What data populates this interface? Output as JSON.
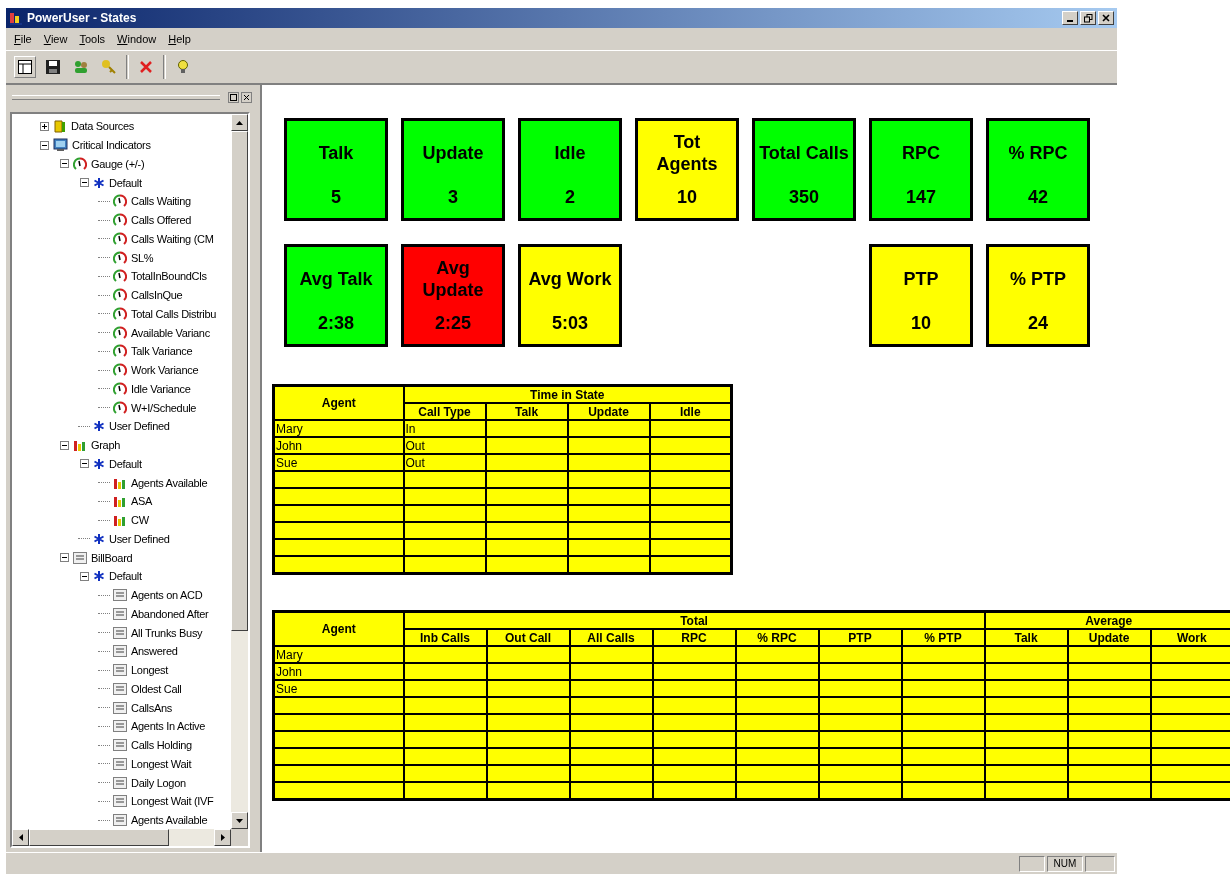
{
  "window": {
    "title": "PowerUser - States"
  },
  "menu": [
    "File",
    "View",
    "Tools",
    "Window",
    "Help"
  ],
  "tree": [
    {
      "label": "Data Sources",
      "kind": "folder",
      "expanded": false
    },
    {
      "label": "Critical Indicators",
      "kind": "monitor",
      "expanded": true,
      "children": [
        {
          "label": "Gauge (+/-)",
          "kind": "gauge",
          "expanded": true,
          "children": [
            {
              "label": "Default",
              "kind": "star",
              "expanded": true,
              "children": [
                {
                  "label": "Calls Waiting",
                  "kind": "gauge"
                },
                {
                  "label": "Calls Offered",
                  "kind": "gauge"
                },
                {
                  "label": "Calls Waiting (CM",
                  "kind": "gauge"
                },
                {
                  "label": "SL%",
                  "kind": "gauge"
                },
                {
                  "label": "TotalInBoundCls",
                  "kind": "gauge"
                },
                {
                  "label": "CallsInQue",
                  "kind": "gauge"
                },
                {
                  "label": "Total Calls Distribu",
                  "kind": "gauge"
                },
                {
                  "label": "Available Varianc",
                  "kind": "gauge"
                },
                {
                  "label": "Talk Variance",
                  "kind": "gauge"
                },
                {
                  "label": "Work Variance",
                  "kind": "gauge"
                },
                {
                  "label": "Idle Variance",
                  "kind": "gauge"
                },
                {
                  "label": "W+I/Schedule",
                  "kind": "gauge"
                }
              ]
            },
            {
              "label": "User Defined",
              "kind": "star"
            }
          ]
        },
        {
          "label": "Graph",
          "kind": "graph",
          "expanded": true,
          "children": [
            {
              "label": "Default",
              "kind": "star",
              "expanded": true,
              "children": [
                {
                  "label": "Agents Available",
                  "kind": "graph"
                },
                {
                  "label": "ASA",
                  "kind": "graph"
                },
                {
                  "label": "CW",
                  "kind": "graph"
                }
              ]
            },
            {
              "label": "User Defined",
              "kind": "star"
            }
          ]
        },
        {
          "label": "BillBoard",
          "kind": "billboard",
          "expanded": true,
          "children": [
            {
              "label": "Default",
              "kind": "star",
              "expanded": true,
              "children": [
                {
                  "label": "Agents on ACD",
                  "kind": "billboard"
                },
                {
                  "label": "Abandoned After",
                  "kind": "billboard"
                },
                {
                  "label": "All Trunks Busy",
                  "kind": "billboard"
                },
                {
                  "label": "Answered",
                  "kind": "billboard"
                },
                {
                  "label": "Longest",
                  "kind": "billboard"
                },
                {
                  "label": "Oldest Call",
                  "kind": "billboard"
                },
                {
                  "label": "CallsAns",
                  "kind": "billboard"
                },
                {
                  "label": "Agents In Active",
                  "kind": "billboard"
                },
                {
                  "label": "Calls Holding",
                  "kind": "billboard"
                },
                {
                  "label": "Longest Wait",
                  "kind": "billboard"
                },
                {
                  "label": "Daily Logon",
                  "kind": "billboard"
                },
                {
                  "label": "Longest Wait (IVF",
                  "kind": "billboard"
                },
                {
                  "label": "Agents Available",
                  "kind": "billboard"
                }
              ]
            }
          ]
        }
      ]
    }
  ],
  "tiles": {
    "top": [
      {
        "label": "Talk",
        "value": "5",
        "color": "#00ff00"
      },
      {
        "label": "Update",
        "value": "3",
        "color": "#00ff00"
      },
      {
        "label": "Idle",
        "value": "2",
        "color": "#00ff00"
      },
      {
        "label": "Tot Agents",
        "value": "10",
        "color": "#ffff00"
      },
      {
        "label": "Total Calls",
        "value": "350",
        "color": "#00ff00"
      },
      {
        "label": "RPC",
        "value": "147",
        "color": "#00ff00"
      },
      {
        "label": "% RPC",
        "value": "42",
        "color": "#00ff00"
      }
    ],
    "bottom_left": [
      {
        "label": "Avg Talk",
        "value": "2:38",
        "color": "#00ff00"
      },
      {
        "label": "Avg Update",
        "value": "2:25",
        "color": "#ff0000"
      },
      {
        "label": "Avg Work",
        "value": "5:03",
        "color": "#ffff00"
      }
    ],
    "bottom_right": [
      {
        "label": "PTP",
        "value": "10",
        "color": "#ffff00"
      },
      {
        "label": "% PTP",
        "value": "24",
        "color": "#ffff00"
      }
    ]
  },
  "state_table": {
    "agent_header": "Agent",
    "group_header": "Time in State",
    "columns": [
      "Call Type",
      "Talk",
      "Update",
      "Idle"
    ],
    "rows": [
      {
        "agent": "Mary",
        "call_type": "In"
      },
      {
        "agent": "John",
        "call_type": "Out"
      },
      {
        "agent": "Sue",
        "call_type": "Out"
      }
    ]
  },
  "totals_table": {
    "agent_header": "Agent",
    "groups": [
      {
        "title": "Total",
        "columns": [
          "Inb Calls",
          "Out Call",
          "All Calls",
          "RPC",
          "% RPC",
          "PTP",
          "% PTP"
        ]
      },
      {
        "title": "Average",
        "columns": [
          "Talk",
          "Update",
          "Work"
        ]
      }
    ],
    "rows": [
      {
        "agent": "Mary"
      },
      {
        "agent": "John"
      },
      {
        "agent": "Sue"
      }
    ]
  },
  "status_bar": {
    "indicator": "NUM"
  }
}
